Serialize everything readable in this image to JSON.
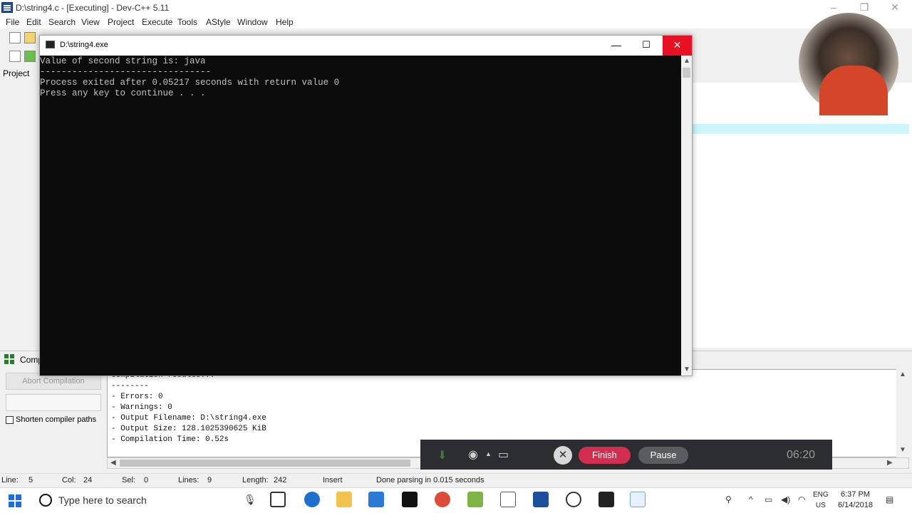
{
  "app": {
    "title": "D:\\string4.c - [Executing] - Dev-C++ 5.11",
    "minimize": "–",
    "restore": "❐",
    "close": "✕"
  },
  "menu": [
    "File",
    "Edit",
    "Search",
    "View",
    "Project",
    "Execute",
    "Tools",
    "AStyle",
    "Window",
    "Help"
  ],
  "left_panel": {
    "project_tab": "Project"
  },
  "console": {
    "title": "D:\\string4.exe",
    "minimize": "—",
    "maximize": "☐",
    "close": "✕",
    "lines": [
      "Value of second string is: java",
      "--------------------------------",
      "Process exited after 0.05217 seconds with return value 0",
      "Press any key to continue . . ."
    ]
  },
  "compiler": {
    "tab_label": "Comp",
    "abort_button": "Abort Compilation",
    "shorten_paths_label": "Shorten compiler paths",
    "log": [
      "Compilation results...",
      "--------",
      "- Errors: 0",
      "- Warnings: 0",
      "- Output Filename: D:\\string4.exe",
      "- Output Size: 128.1025390625 KiB",
      "- Compilation Time: 0.52s"
    ]
  },
  "status": {
    "line_label": "Line:",
    "line_value": "5",
    "col_label": "Col:",
    "col_value": "24",
    "sel_label": "Sel:",
    "sel_value": "0",
    "lines_label": "Lines:",
    "lines_value": "9",
    "length_label": "Length:",
    "length_value": "242",
    "mode": "Insert",
    "message": "Done parsing in 0.015 seconds"
  },
  "recorder": {
    "cancel": "✕",
    "finish": "Finish",
    "pause": "Pause",
    "time": "06:20"
  },
  "taskbar": {
    "search_placeholder": "Type here to search",
    "lang_top": "ENG",
    "lang_bottom": "US",
    "time": "6:37 PM",
    "date": "6/14/2018"
  },
  "colors": {
    "console_bg": "#0c0c0c",
    "close_red": "#e81123",
    "finish_pink": "#d32e4f",
    "recorder_bg": "#2c2d30",
    "editor_highlight": "#ccf6fb"
  }
}
